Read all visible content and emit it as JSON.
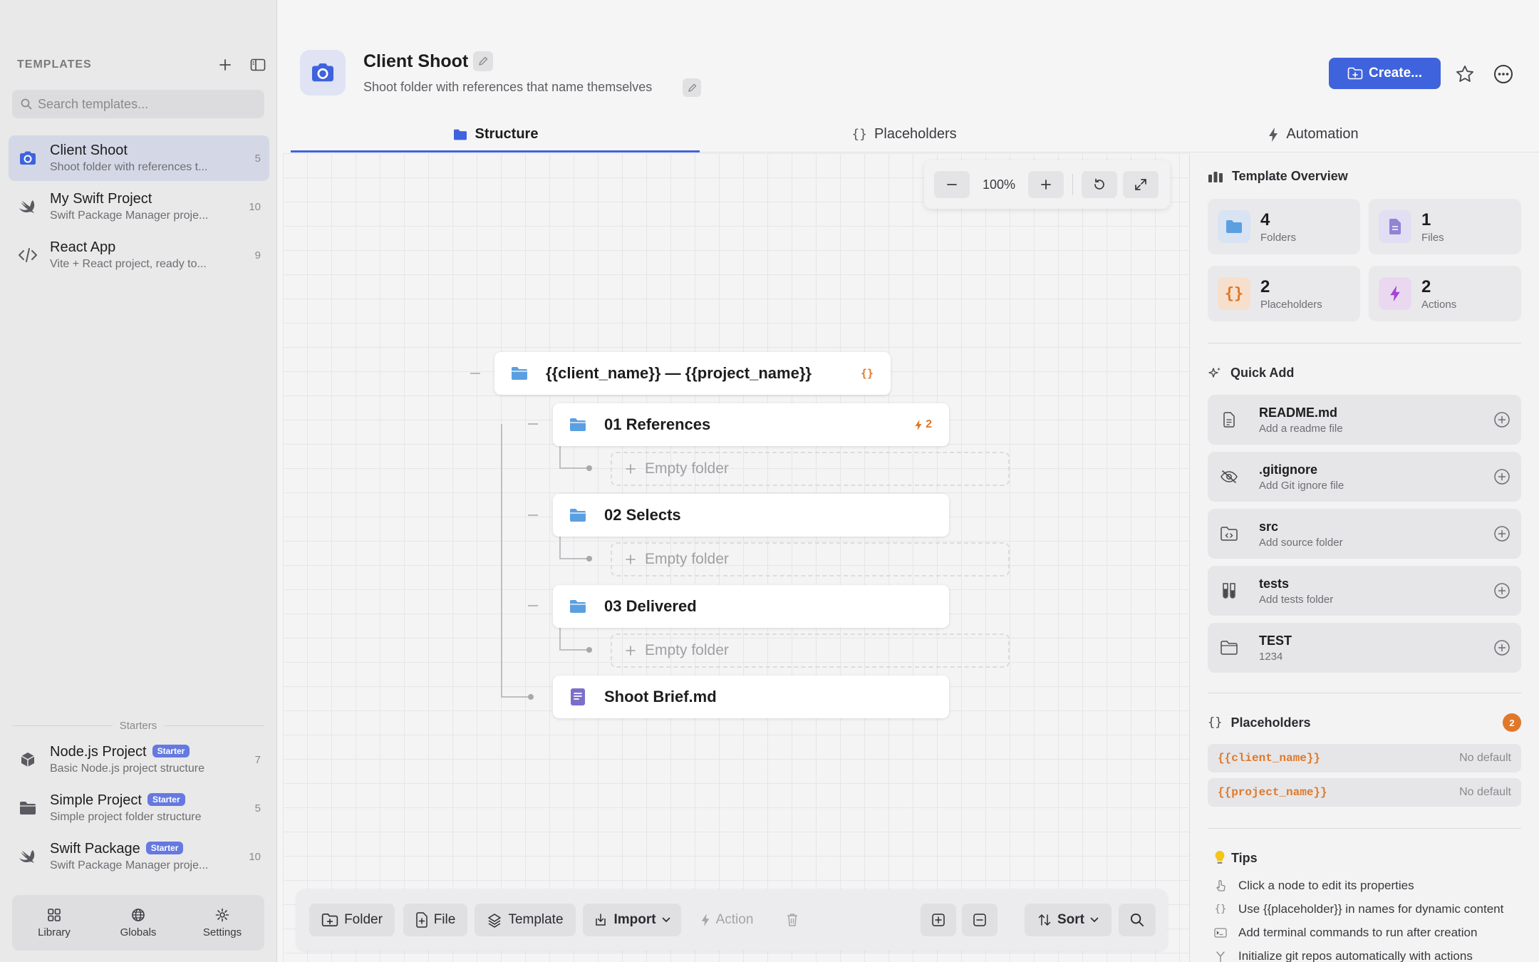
{
  "sidebar": {
    "title": "TEMPLATES",
    "search_placeholder": "Search templates...",
    "templates": [
      {
        "name": "Client Shoot",
        "desc": "Shoot folder with references t...",
        "count": "5",
        "icon": "camera-icon",
        "active": true
      },
      {
        "name": "My Swift Project",
        "desc": "Swift Package Manager proje...",
        "count": "10",
        "icon": "swift-icon"
      },
      {
        "name": "React App",
        "desc": "Vite + React project, ready to...",
        "count": "9",
        "icon": "code-icon"
      }
    ],
    "starters_label": "Starters",
    "starter_badge": "Starter",
    "starters": [
      {
        "name": "Node.js Project",
        "desc": "Basic Node.js project structure",
        "count": "7",
        "icon": "box-icon"
      },
      {
        "name": "Simple Project",
        "desc": "Simple project folder structure",
        "count": "5",
        "icon": "folder-icon"
      },
      {
        "name": "Swift Package",
        "desc": "Swift Package Manager proje...",
        "count": "10",
        "icon": "swift-icon"
      }
    ],
    "bottom_tabs": [
      "Library",
      "Globals",
      "Settings"
    ]
  },
  "header": {
    "title": "Client Shoot",
    "subtitle": "Shoot folder with references that name themselves",
    "create_label": "Create..."
  },
  "tabs": [
    "Structure",
    "Placeholders",
    "Automation"
  ],
  "active_tab": "Structure",
  "canvas": {
    "zoom": "100%",
    "root": {
      "label": "{{client_name}} — {{project_name}}",
      "badge": "{}"
    },
    "children": [
      {
        "label": "01 References",
        "type": "folder",
        "badge": "2",
        "empty_label": "Empty folder"
      },
      {
        "label": "02 Selects",
        "type": "folder",
        "empty_label": "Empty folder"
      },
      {
        "label": "03 Delivered",
        "type": "folder",
        "empty_label": "Empty folder"
      },
      {
        "label": "Shoot Brief.md",
        "type": "file"
      }
    ]
  },
  "toolbar": {
    "folder": "Folder",
    "file": "File",
    "template": "Template",
    "import": "Import",
    "action": "Action",
    "sort": "Sort"
  },
  "overview": {
    "title": "Template Overview",
    "stats": [
      {
        "num": "4",
        "label": "Folders"
      },
      {
        "num": "1",
        "label": "Files"
      },
      {
        "num": "2",
        "label": "Placeholders"
      },
      {
        "num": "2",
        "label": "Actions"
      }
    ]
  },
  "quick_add": {
    "title": "Quick Add",
    "items": [
      {
        "name": "README.md",
        "desc": "Add a readme file",
        "icon": "file-icon"
      },
      {
        "name": ".gitignore",
        "desc": "Add Git ignore file",
        "icon": "eye-slash-icon"
      },
      {
        "name": "src",
        "desc": "Add source folder",
        "icon": "folder-code-icon"
      },
      {
        "name": "tests",
        "desc": "Add tests folder",
        "icon": "test-tubes-icon"
      },
      {
        "name": "TEST",
        "desc": "1234",
        "icon": "folder-icon"
      }
    ]
  },
  "placeholders": {
    "title": "Placeholders",
    "count": "2",
    "items": [
      {
        "code": "{{client_name}}",
        "default": "No default"
      },
      {
        "code": "{{project_name}}",
        "default": "No default"
      }
    ]
  },
  "tips": {
    "title": "Tips",
    "items": [
      "Click a node to edit its properties",
      "Use {{placeholder}} in names for dynamic content",
      "Add terminal commands to run after creation",
      "Initialize git repos automatically with actions"
    ]
  },
  "colors": {
    "accent": "#3f63dc",
    "placeholder_orange": "#e0782a",
    "folder_blue": "#5b9fe0"
  }
}
